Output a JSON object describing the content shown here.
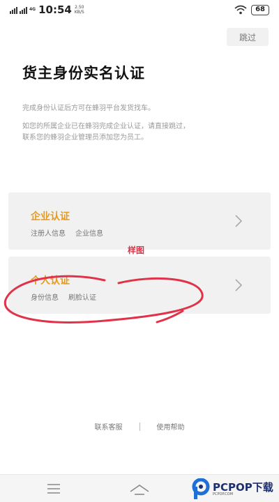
{
  "status_bar": {
    "network": "4G",
    "time": "10:54",
    "speed_value": "2.50",
    "speed_unit": "KB/S",
    "battery": "68"
  },
  "skip_label": "跳过",
  "title": "货主身份实名认证",
  "description": {
    "line1": "完成身份认证后方可在蜂羽平台发货找车。",
    "line2": "如您的所属企业已在蜂羽完成企业认证，请直接跳过，",
    "line3": "联系您的蜂羽企业管理员添加您为员工。"
  },
  "cards": {
    "company": {
      "title": "企业认证",
      "sub1": "注册人信息",
      "sub2": "企业信息"
    },
    "personal": {
      "title": "个人认证",
      "sub1": "身份信息",
      "sub2": "刷脸认证"
    }
  },
  "annotation": {
    "label": "样图"
  },
  "footer": {
    "contact": "联系客服",
    "help": "使用帮助"
  },
  "watermark": {
    "brand": "PCPOP下载",
    "tagline": "PCPOP.COM"
  },
  "icons": {
    "card_arrow": "chevron-right-icon",
    "nav_menu": "menu-icon",
    "nav_home": "home-icon"
  },
  "colors": {
    "accent": "#e69a1e",
    "annotation": "#e0334a",
    "card_bg": "#f1f1f1"
  }
}
